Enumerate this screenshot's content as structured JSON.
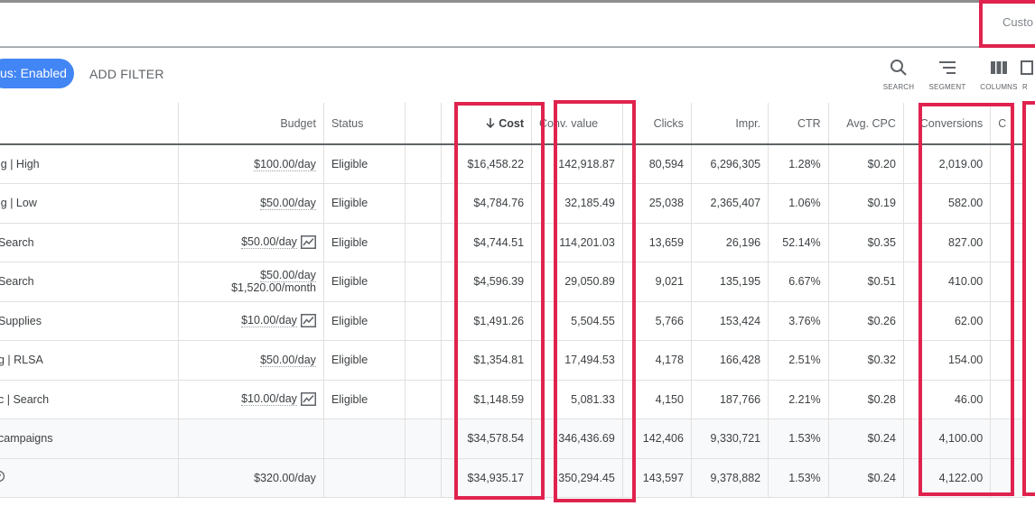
{
  "header": {
    "custom_label": "Custo"
  },
  "filter": {
    "status_chip": "us: Enabled",
    "add_filter": "ADD FILTER"
  },
  "toolbar": {
    "search": "SEARCH",
    "segment": "SEGMENT",
    "columns": "COLUMNS",
    "partial": "R"
  },
  "table": {
    "columns": {
      "budget": "Budget",
      "status": "Status",
      "cost": "Cost",
      "conv_value": "Conv. value",
      "clicks": "Clicks",
      "impr": "Impr.",
      "ctr": "CTR",
      "avg_cpc": "Avg. CPC",
      "conversions": "Conversions",
      "partial": "C"
    },
    "rows": [
      {
        "name": "ig | High",
        "budget": "$100.00/day",
        "budget2": "",
        "chart": false,
        "status": "Eligible",
        "cost": "$16,458.22",
        "conv_value": "142,918.87",
        "clicks": "80,594",
        "impr": "6,296,305",
        "ctr": "1.28%",
        "avg_cpc": "$0.20",
        "conversions": "2,019.00"
      },
      {
        "name": "ig | Low",
        "budget": "$50.00/day",
        "budget2": "",
        "chart": false,
        "status": "Eligible",
        "cost": "$4,784.76",
        "conv_value": "32,185.49",
        "clicks": "25,038",
        "impr": "2,365,407",
        "ctr": "1.06%",
        "avg_cpc": "$0.19",
        "conversions": "582.00"
      },
      {
        "name": "Search",
        "budget": "$50.00/day",
        "budget2": "",
        "chart": true,
        "status": "Eligible",
        "cost": "$4,744.51",
        "conv_value": "114,201.03",
        "clicks": "13,659",
        "impr": "26,196",
        "ctr": "52.14%",
        "avg_cpc": "$0.35",
        "conversions": "827.00"
      },
      {
        "name": "Search",
        "budget": "$50.00/day",
        "budget2": "$1,520.00/month",
        "chart": false,
        "status": "Eligible",
        "cost": "$4,596.39",
        "conv_value": "29,050.89",
        "clicks": "9,021",
        "impr": "135,195",
        "ctr": "6.67%",
        "avg_cpc": "$0.51",
        "conversions": "410.00"
      },
      {
        "name": "Supplies",
        "budget": "$10.00/day",
        "budget2": "",
        "chart": true,
        "status": "Eligible",
        "cost": "$1,491.26",
        "conv_value": "5,504.55",
        "clicks": "5,766",
        "impr": "153,424",
        "ctr": "3.76%",
        "avg_cpc": "$0.26",
        "conversions": "62.00"
      },
      {
        "name": "g | RLSA",
        "budget": "$50.00/day",
        "budget2": "",
        "chart": false,
        "status": "Eligible",
        "cost": "$1,354.81",
        "conv_value": "17,494.53",
        "clicks": "4,178",
        "impr": "166,428",
        "ctr": "2.51%",
        "avg_cpc": "$0.32",
        "conversions": "154.00"
      },
      {
        "name": "c | Search",
        "budget": "$10.00/day",
        "budget2": "",
        "chart": true,
        "status": "Eligible",
        "cost": "$1,148.59",
        "conv_value": "5,081.33",
        "clicks": "4,150",
        "impr": "187,766",
        "ctr": "2.21%",
        "avg_cpc": "$0.28",
        "conversions": "46.00"
      }
    ],
    "totals": [
      {
        "label": "campaigns",
        "budget": "",
        "cost": "$34,578.54",
        "conv_value": "346,436.69",
        "clicks": "142,406",
        "impr": "9,330,721",
        "ctr": "1.53%",
        "avg_cpc": "$0.24",
        "conversions": "4,100.00"
      },
      {
        "label": "",
        "budget": "$320.00/day",
        "cost": "$34,935.17",
        "conv_value": "350,294.45",
        "clicks": "143,597",
        "impr": "9,378,882",
        "ctr": "1.53%",
        "avg_cpc": "$0.24",
        "conversions": "4,122.00"
      }
    ]
  },
  "colors": {
    "accent": "#4285f4",
    "link": "#1a73e8",
    "highlight": "#e0234e"
  }
}
